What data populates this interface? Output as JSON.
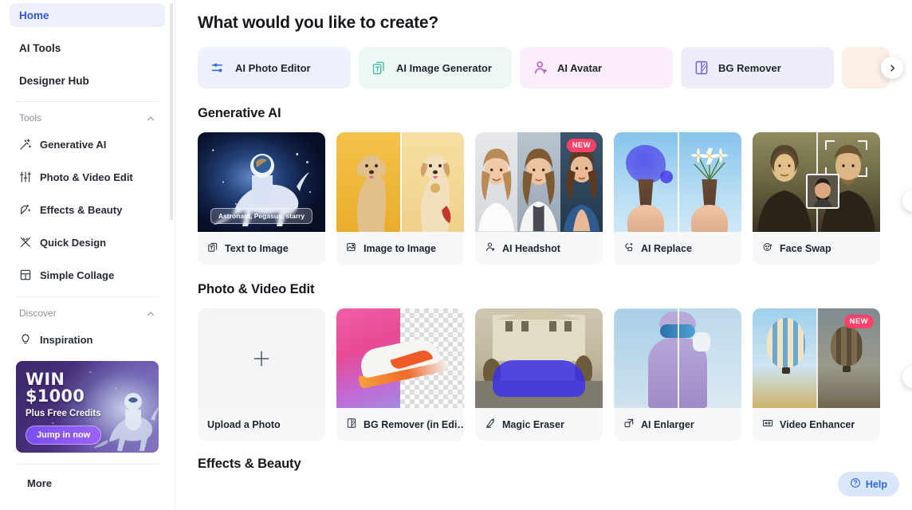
{
  "sidebar": {
    "top_links": [
      {
        "label": "Home",
        "active": true
      },
      {
        "label": "AI Tools",
        "active": false
      },
      {
        "label": "Designer Hub",
        "active": false
      }
    ],
    "groups": [
      {
        "title": "Tools",
        "items": [
          {
            "label": "Generative AI",
            "icon": "magic-wand-icon"
          },
          {
            "label": "Photo & Video Edit",
            "icon": "sliders-icon"
          },
          {
            "label": "Effects & Beauty",
            "icon": "sparkle-wand-icon"
          },
          {
            "label": "Quick Design",
            "icon": "crossed-wands-icon"
          },
          {
            "label": "Simple Collage",
            "icon": "collage-grid-icon"
          }
        ]
      },
      {
        "title": "Discover",
        "items": [
          {
            "label": "Inspiration",
            "icon": "lightbulb-icon"
          }
        ]
      }
    ],
    "promo": {
      "headline": "WIN $1000",
      "subline": "Plus Free Credits",
      "button": "Jump in now"
    },
    "more_label": "More"
  },
  "main": {
    "title": "What would you like to create?",
    "quick_chips": [
      {
        "label": "AI Photo Editor",
        "icon": "photo-editor-icon",
        "bg": "#eef1fb",
        "color": "#3b6ae0"
      },
      {
        "label": "AI Image Generator",
        "icon": "image-generator-icon",
        "bg": "#edf8f5",
        "color": "#4bb9ae"
      },
      {
        "label": "AI Avatar",
        "icon": "avatar-icon",
        "bg": "#fbeefa",
        "color": "#b656d6"
      },
      {
        "label": "BG Remover",
        "icon": "bg-remover-icon",
        "bg": "#eeedfc",
        "color": "#6c5ce7"
      },
      {
        "label": "",
        "icon": "",
        "bg": "#fdeee6",
        "color": "#e08a5a"
      }
    ],
    "sections": [
      {
        "title": "Generative AI",
        "cards": [
          {
            "label": "Text to Image",
            "icon": "text-to-image-icon",
            "badge": "",
            "prompt": "Astronaut, Pegasus, starry"
          },
          {
            "label": "Image to Image",
            "icon": "image-to-image-icon",
            "badge": "",
            "prompt": ""
          },
          {
            "label": "AI Headshot",
            "icon": "headshot-icon",
            "badge": "NEW",
            "prompt": ""
          },
          {
            "label": "AI Replace",
            "icon": "replace-icon",
            "badge": "",
            "prompt": ""
          },
          {
            "label": "Face Swap",
            "icon": "face-swap-icon",
            "badge": "",
            "prompt": ""
          }
        ]
      },
      {
        "title": "Photo & Video Edit",
        "cards": [
          {
            "label": "Upload a Photo",
            "icon": "",
            "badge": "",
            "prompt": ""
          },
          {
            "label": "BG Remover (in Edi…",
            "icon": "bg-remover-icon",
            "badge": "",
            "prompt": ""
          },
          {
            "label": "Magic Eraser",
            "icon": "eraser-icon",
            "badge": "",
            "prompt": ""
          },
          {
            "label": "AI Enlarger",
            "icon": "enlarge-icon",
            "badge": "",
            "prompt": ""
          },
          {
            "label": "Video Enhancer",
            "icon": "hd-icon",
            "badge": "NEW",
            "prompt": ""
          }
        ]
      },
      {
        "title": "Effects & Beauty",
        "cards": []
      }
    ],
    "help_label": "Help"
  },
  "colors": {
    "accent_blue": "#3355ee",
    "badge_new": "#ff4169",
    "help_bg": "#d9e6fb",
    "help_text": "#2e6ae6"
  }
}
